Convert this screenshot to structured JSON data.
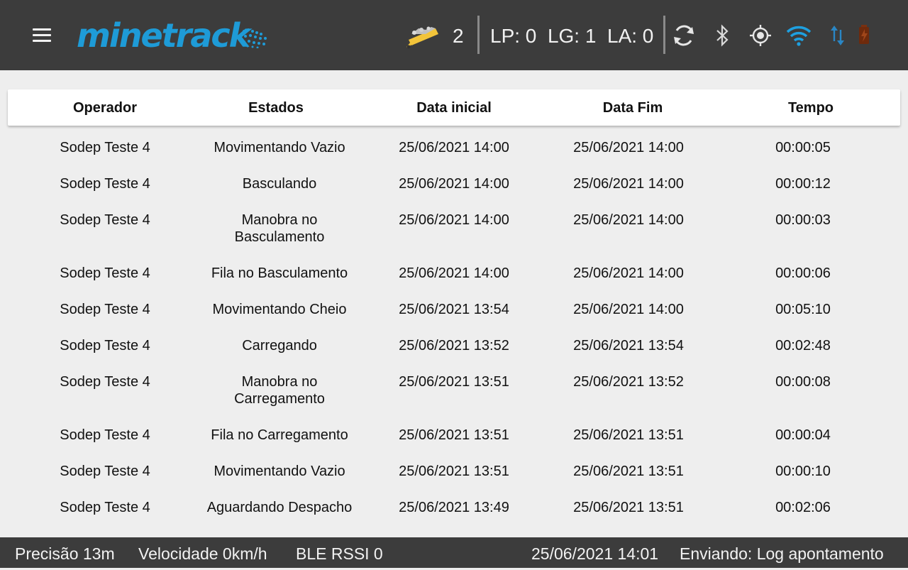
{
  "header": {
    "logo_text": "minetrack",
    "truck_count": "2",
    "lp": "LP: 0",
    "lg": "LG: 1",
    "la": "LA: 0"
  },
  "colors": {
    "topbar": "#3c3c3c",
    "brand": "#1e9bd7",
    "truck": "#f2c43a",
    "background": "#eeeeee"
  },
  "icons": [
    "menu-icon",
    "truck-icon",
    "sync-icon",
    "bluetooth-icon",
    "gps-icon",
    "wifi-icon",
    "data-transfer-icon",
    "battery-icon"
  ],
  "table": {
    "columns": [
      "Operador",
      "Estados",
      "Data inicial",
      "Data Fim",
      "Tempo"
    ],
    "rows": [
      [
        "Sodep Teste 4",
        "Movimentando Vazio",
        "25/06/2021 14:00",
        "25/06/2021 14:00",
        "00:00:05"
      ],
      [
        "Sodep Teste 4",
        "Basculando",
        "25/06/2021 14:00",
        "25/06/2021 14:00",
        "00:00:12"
      ],
      [
        "Sodep Teste 4",
        "Manobra no Basculamento",
        "25/06/2021 14:00",
        "25/06/2021 14:00",
        "00:00:03"
      ],
      [
        "Sodep Teste 4",
        "Fila no Basculamento",
        "25/06/2021 14:00",
        "25/06/2021 14:00",
        "00:00:06"
      ],
      [
        "Sodep Teste 4",
        "Movimentando Cheio",
        "25/06/2021 13:54",
        "25/06/2021 14:00",
        "00:05:10"
      ],
      [
        "Sodep Teste 4",
        "Carregando",
        "25/06/2021 13:52",
        "25/06/2021 13:54",
        "00:02:48"
      ],
      [
        "Sodep Teste 4",
        "Manobra no Carregamento",
        "25/06/2021 13:51",
        "25/06/2021 13:52",
        "00:00:08"
      ],
      [
        "Sodep Teste 4",
        "Fila no Carregamento",
        "25/06/2021 13:51",
        "25/06/2021 13:51",
        "00:00:04"
      ],
      [
        "Sodep Teste 4",
        "Movimentando Vazio",
        "25/06/2021 13:51",
        "25/06/2021 13:51",
        "00:00:10"
      ],
      [
        "Sodep Teste 4",
        "Aguardando Despacho",
        "25/06/2021 13:49",
        "25/06/2021 13:51",
        "00:02:06"
      ]
    ]
  },
  "footer": {
    "precision": "Precisão  13m",
    "speed": "Velocidade  0km/h",
    "ble": "BLE RSSI  0",
    "datetime": "25/06/2021 14:01",
    "sending": "Enviando: Log apontamento"
  }
}
